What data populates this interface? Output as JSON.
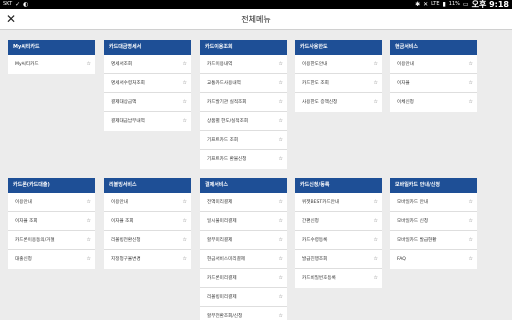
{
  "status_bar": {
    "carrier": "SKT",
    "battery": "11%",
    "time": "오후 9:18",
    "network": "LTE"
  },
  "header": {
    "title": "전체메뉴",
    "close_glyph": "✕"
  },
  "icons": {
    "star": "☆",
    "close": "close-icon",
    "favorite": "star-icon"
  },
  "colors": {
    "header_blue": "#1e4f96",
    "background": "#ececec"
  },
  "menus": [
    {
      "title": "My씨티카드",
      "items": [
        "My씨티카드"
      ]
    },
    {
      "title": "카드대금명세서",
      "items": [
        "명세서조회",
        "명세서수령처조회",
        "결제대상금액",
        "결제대금납부내역"
      ]
    },
    {
      "title": "카드이용조회",
      "items": [
        "카드이용내역",
        "교통카드사용내역",
        "카드발기관 실적조회",
        "상품별 한도/실적조회",
        "기프트카드 조회",
        "기프트카드 환불신청"
      ]
    },
    {
      "title": "카드사용한도",
      "items": [
        "이용한도안내",
        "카드한도 조회",
        "사용한도 증액신청"
      ]
    },
    {
      "title": "현금서비스",
      "items": [
        "이용안내",
        "이자율",
        "이체신청"
      ]
    },
    {
      "title": "카드론(카드대출)",
      "items": [
        "이용안내",
        "이자율 조회",
        "카드론이용동의/거절",
        "대출신청"
      ]
    },
    {
      "title": "리볼빙서비스",
      "items": [
        "이용안내",
        "이자율 조회",
        "리볼빙전환신청",
        "지정청구율변경"
      ]
    },
    {
      "title": "결제서비스",
      "items": [
        "전액미리결제",
        "일시불미리결제",
        "할부미리결제",
        "현금서비스미리결제",
        "카드론미리결제",
        "리볼빙미리결제",
        "할부전환조회/신청"
      ]
    },
    {
      "title": "카드신청/등록",
      "items": [
        "위젯BEST카드안내",
        "간편신청",
        "카드수령등록",
        "발급진행조회",
        "카드비밀번호등록"
      ]
    },
    {
      "title": "모바일카드 안내/신청",
      "items": [
        "모바일카드 안내",
        "모바일카드 신청",
        "모바일카드 발급현황",
        "FAQ"
      ]
    }
  ]
}
